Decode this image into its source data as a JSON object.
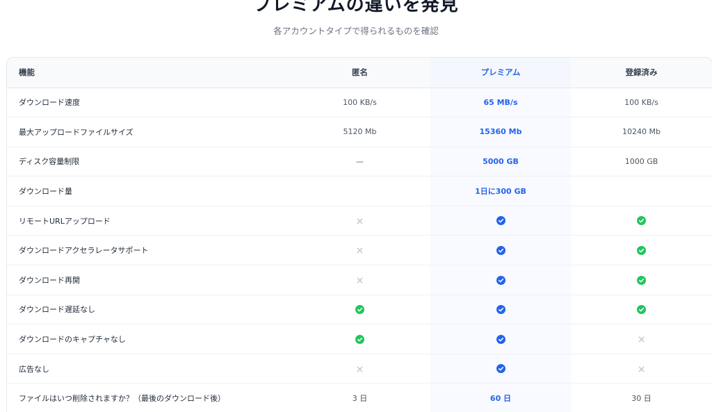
{
  "header": {
    "title": "プレミアムの違いを発見",
    "subtitle": "各アカウントタイプで得られるものを確認"
  },
  "colors": {
    "premium_accent": "#2563eb",
    "check_green": "#22c55e",
    "cross_gray": "#c7cbd1"
  },
  "table": {
    "columns": {
      "feature": "機能",
      "anonymous": "匿名",
      "premium": "プレミアム",
      "registered": "登録済み"
    },
    "rows": [
      {
        "feature": "ダウンロード速度",
        "anonymous": "100 KB/s",
        "premium": "65 MB/s",
        "registered": "100 KB/s"
      },
      {
        "feature": "最大アップロードファイルサイズ",
        "anonymous": "5120 Mb",
        "premium": "15360 Mb",
        "registered": "10240 Mb"
      },
      {
        "feature": "ディスク容量制限",
        "anonymous": "—",
        "premium": "5000 GB",
        "registered": "1000 GB"
      },
      {
        "feature": "ダウンロード量",
        "anonymous": "",
        "premium": "1日に300 GB",
        "registered": ""
      },
      {
        "feature": "リモートURLアップロード",
        "anonymous": "cross-icon",
        "premium": "check-icon",
        "registered": "check-icon"
      },
      {
        "feature": "ダウンロードアクセラレータサポート",
        "anonymous": "cross-icon",
        "premium": "check-icon",
        "registered": "check-icon"
      },
      {
        "feature": "ダウンロード再開",
        "anonymous": "cross-icon",
        "premium": "check-icon",
        "registered": "check-icon"
      },
      {
        "feature": "ダウンロード遅延なし",
        "anonymous": "check-icon",
        "premium": "check-icon",
        "registered": "check-icon"
      },
      {
        "feature": "ダウンロードのキャプチャなし",
        "anonymous": "check-icon",
        "premium": "check-icon",
        "registered": "cross-icon"
      },
      {
        "feature": "広告なし",
        "anonymous": "cross-icon",
        "premium": "check-icon",
        "registered": "cross-icon"
      },
      {
        "feature": "ファイルはいつ削除されますか？（最後のダウンロード後）",
        "anonymous": "3 日",
        "premium": "60 日",
        "registered": "30 日"
      }
    ]
  }
}
